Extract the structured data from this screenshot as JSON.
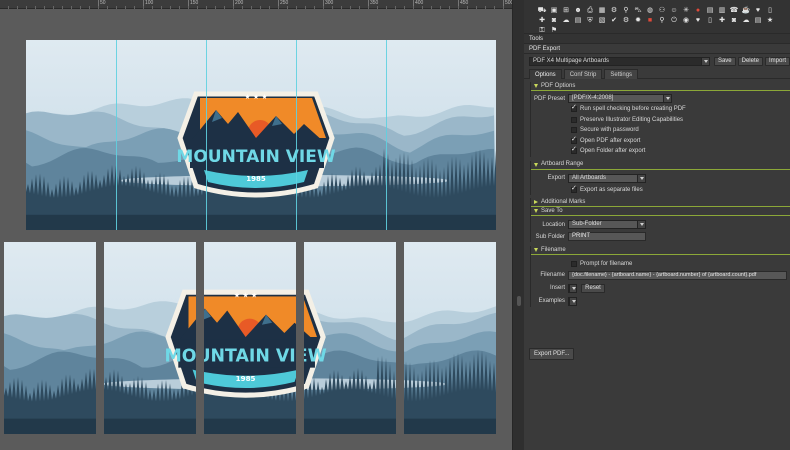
{
  "ruler": {
    "labels": [
      "50",
      "100",
      "150",
      "200",
      "250",
      "300",
      "350",
      "400",
      "450",
      "500"
    ]
  },
  "artwork": {
    "badge_title": "MOUNTAIN VIEW",
    "badge_year": "1985"
  },
  "panel": {
    "icons": [
      "bus-icon",
      "box-icon",
      "plus-box-icon",
      "user-icon",
      "printer-icon",
      "table-icon",
      "gear-icon",
      "pin-icon",
      "car-icon",
      "bell-icon",
      "glasses-icon",
      "mask-icon",
      "light-icon",
      "red-stop-icon",
      "calendar-icon",
      "film-icon",
      "phone-icon",
      "cup-icon",
      "heart-icon",
      "document-icon",
      "puzzle-icon",
      "camera-icon",
      "cloud-icon",
      "notes-icon",
      "shield-icon",
      "clipboard-icon",
      "check-icon",
      "cog-icon",
      "fire-icon",
      "red-square-icon",
      "bicycle-icon",
      "power-icon",
      "speaker-icon",
      "heart2-icon",
      "document2-icon",
      "puzzle2-icon",
      "camera2-icon",
      "cloud2-icon",
      "notes2-icon",
      "star-icon",
      "lock-icon",
      "flag-icon"
    ],
    "tools_label": "Tools",
    "pdf_export_label": "PDF Export",
    "preset_name": "PDF X4 Multipage Artboards",
    "save_label": "Save",
    "delete_label": "Delete",
    "import_label": "Import",
    "tabs": [
      "Options",
      "Conf Strip",
      "Settings"
    ],
    "pdf_options": {
      "title": "PDF Options",
      "preset_label": "PDF Preset",
      "preset_value": "[PDF/X-4:2008]",
      "checks": [
        {
          "label": "Run spell checking before creating PDF",
          "checked": true
        },
        {
          "label": "Preserve Illustrator Editing Capabilities",
          "checked": false
        },
        {
          "label": "Secure with password",
          "checked": false
        },
        {
          "label": "Open PDF after export",
          "checked": true
        },
        {
          "label": "Open Folder after export",
          "checked": true
        }
      ]
    },
    "artboard_range": {
      "title": "Artboard Range",
      "export_label": "Export",
      "export_value": "All Artboards",
      "separate_label": "Export as separate files",
      "separate_checked": true
    },
    "additional_marks": {
      "title": "Additional Marks"
    },
    "save_to": {
      "title": "Save To",
      "location_label": "Location",
      "location_value": "Sub-Folder",
      "subfolder_label": "Sub Folder",
      "subfolder_value": "PRINT"
    },
    "filename": {
      "title": "Filename",
      "prompt_label": "Prompt for filename",
      "prompt_checked": false,
      "filename_label": "Filename",
      "filename_value": "{doc.filename} - {artboard.name} - {artboard.number} of {artboard.count}.pdf",
      "insert_label": "Insert",
      "reset_label": "Reset",
      "examples_label": "Examples"
    },
    "export_button": "Export PDF..."
  }
}
